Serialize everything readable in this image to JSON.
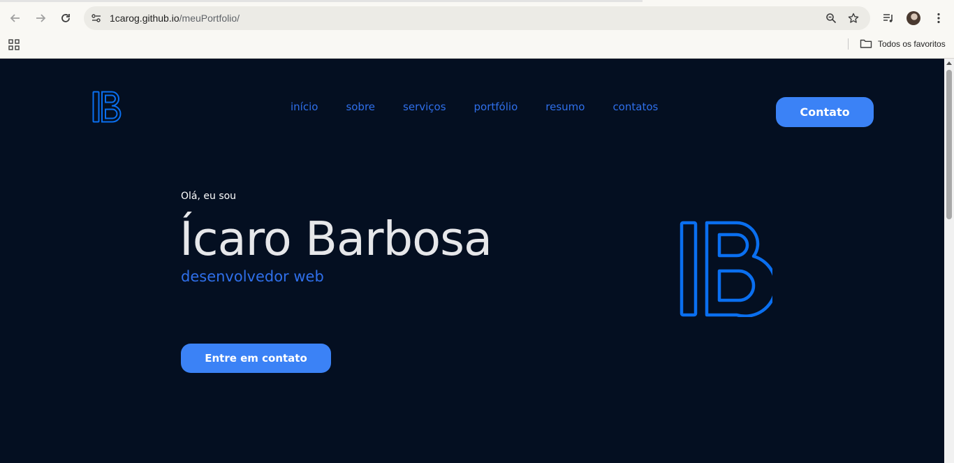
{
  "browser": {
    "url_host": "1carog.github.io",
    "url_path": "/meuPortfolio/",
    "bookmarks_folder_label": "Todos os favoritos"
  },
  "site": {
    "logo_text": "IB",
    "nav": [
      "início",
      "sobre",
      "serviços",
      "portfólio",
      "resumo",
      "contatos"
    ],
    "contact_button": "Contato",
    "hero": {
      "greeting": "Olá, eu sou",
      "name": "Ícaro Barbosa",
      "role": "desenvolvedor web",
      "cta": "Entre em contato"
    }
  },
  "colors": {
    "page_bg": "#040f21",
    "accent": "#3b82f6",
    "logo_blue": "#0a6ff0",
    "nav_text": "#2f6fea"
  }
}
